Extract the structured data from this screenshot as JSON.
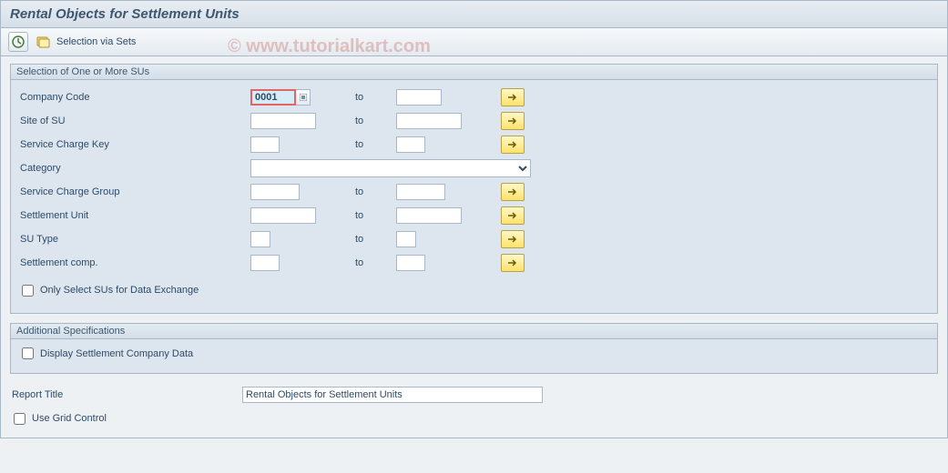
{
  "title": "Rental Objects for Settlement Units",
  "toolbar": {
    "selection_via_sets": "Selection via Sets"
  },
  "group1": {
    "header": "Selection of One or More SUs",
    "rows": {
      "company_code": {
        "label": "Company Code",
        "from": "0001",
        "to_lbl": "to",
        "to": ""
      },
      "site": {
        "label": "Site of SU",
        "from": "",
        "to_lbl": "to",
        "to": ""
      },
      "scharge_key": {
        "label": "Service Charge Key",
        "from": "",
        "to_lbl": "to",
        "to": ""
      },
      "category": {
        "label": "Category",
        "value": ""
      },
      "sc_group": {
        "label": "Service Charge Group",
        "from": "",
        "to_lbl": "to",
        "to": ""
      },
      "settle_unit": {
        "label": "Settlement Unit",
        "from": "",
        "to_lbl": "to",
        "to": ""
      },
      "su_type": {
        "label": "SU Type",
        "from": "",
        "to_lbl": "to",
        "to": ""
      },
      "settle_comp": {
        "label": "Settlement comp.",
        "from": "",
        "to_lbl": "to",
        "to": ""
      }
    },
    "only_select_label": "Only Select SUs for Data Exchange"
  },
  "group2": {
    "header": "Additional Specifications",
    "display_label": "Display Settlement Company Data"
  },
  "report_title_label": "Report Title",
  "report_title_value": "Rental Objects for Settlement Units",
  "use_grid_label": "Use Grid Control",
  "watermark": "© www.tutorialkart.com"
}
